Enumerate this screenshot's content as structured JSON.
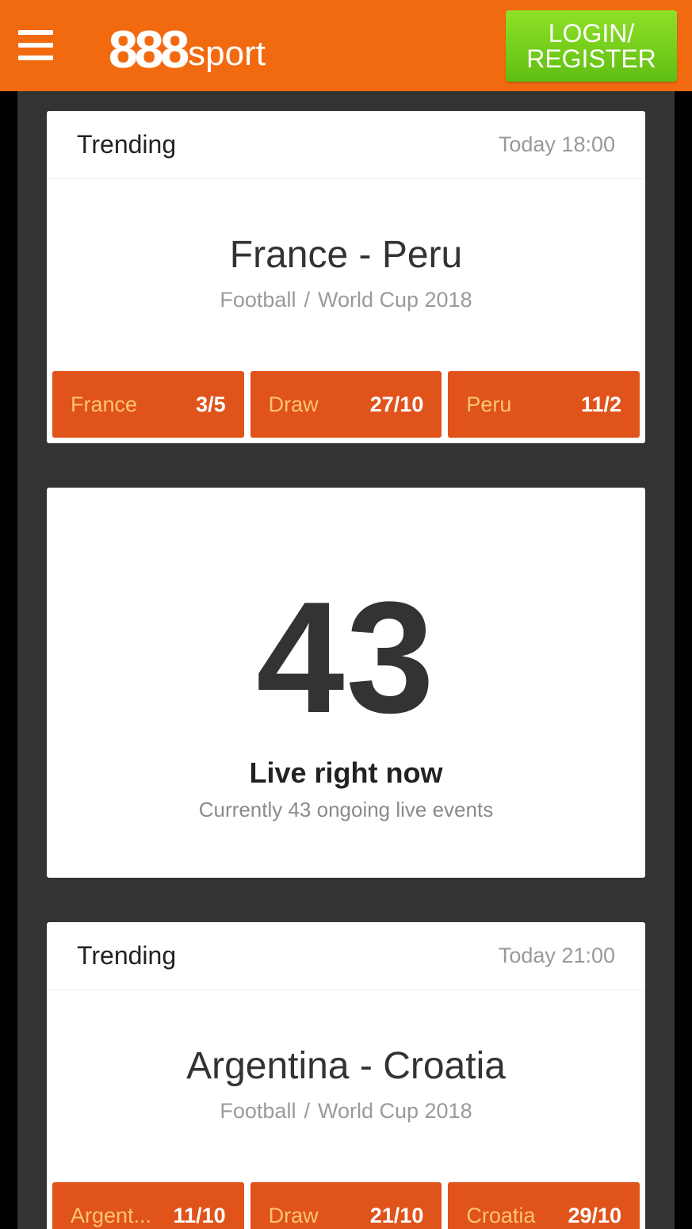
{
  "header": {
    "logo_number": "888",
    "logo_word": "sport",
    "login_label_line1": "LOGIN/",
    "login_label_line2": "REGISTER"
  },
  "cards": [
    {
      "label": "Trending",
      "time": "Today 18:00",
      "match": "France - Peru",
      "sport": "Football",
      "separator": "/",
      "competition": "World Cup 2018",
      "odds": [
        {
          "name": "France",
          "price": "3/5"
        },
        {
          "name": "Draw",
          "price": "27/10"
        },
        {
          "name": "Peru",
          "price": "11/2"
        }
      ]
    },
    {
      "label": "Trending",
      "time": "Today 21:00",
      "match": "Argentina - Croatia",
      "sport": "Football",
      "separator": "/",
      "competition": "World Cup 2018",
      "odds": [
        {
          "name": "Argent...",
          "price": "11/10"
        },
        {
          "name": "Draw",
          "price": "21/10"
        },
        {
          "name": "Croatia",
          "price": "29/10"
        }
      ]
    }
  ],
  "live": {
    "count": "43",
    "title": "Live right now",
    "subtitle": "Currently 43 ongoing live events"
  },
  "colors": {
    "brand_orange": "#f26a10",
    "odds_button": "#e0531b",
    "login_green": "#7dd11f",
    "background_dark": "#333333"
  }
}
